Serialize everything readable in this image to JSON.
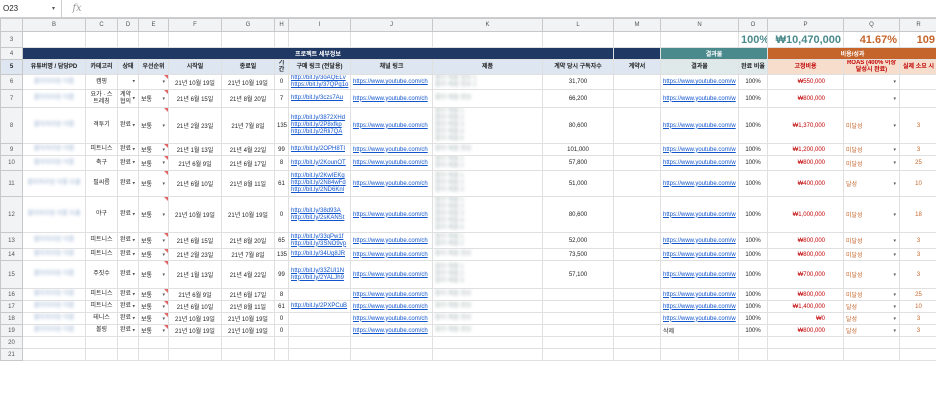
{
  "formula_bar": {
    "cell_ref": "O23",
    "fx": "fx"
  },
  "col_letters": [
    "A",
    "B",
    "C",
    "D",
    "E",
    "F",
    "G",
    "H",
    "I",
    "J",
    "K",
    "L",
    "M",
    "N",
    "O",
    "P",
    "Q",
    "R"
  ],
  "summary": {
    "pct_done": "100%",
    "cost_total": "₩10,470,000",
    "roas_pct": "41.67%",
    "count": "109"
  },
  "groups": {
    "project": "프로젝트 세부정보",
    "result": "결과물",
    "cost": "비용/성과"
  },
  "headers": [
    "유튜버명 / 담당PD",
    "카테고리",
    "상태",
    "우선순위",
    "시작일",
    "종료일",
    "기간",
    "구매 링크 (전달용)",
    "채널 링크",
    "제품",
    "계약 당시 구독자수",
    "계약서",
    "결과물",
    "완료 비율",
    "고정비용",
    "ROAS (400% 이상 달성시 완료)",
    "실제 소요 시"
  ],
  "rows": [
    {
      "rn": "6",
      "name": "블러처리된 이름",
      "cat": "캠핑",
      "status": "",
      "prio": "",
      "start": "21년 10월 19일",
      "end": "21년 10월 19일",
      "days": "0",
      "buy": [
        "http://bit.ly/3oAQELv",
        "https://bit.ly/37QPg1o"
      ],
      "ch": "https://www.youtube.com/ch",
      "prod": [
        "블러 제품 정보 1",
        "블러 제품 정보 2"
      ],
      "subs": "31,700",
      "res": "https://www.youtube.com/w",
      "pct": "100%",
      "fee": "₩550,000",
      "roas": "",
      "act": ""
    },
    {
      "rn": "7",
      "name": "블러처리된 이름",
      "cat": "요가 · 스트레칭",
      "status": "계약 협의",
      "prio": "보통",
      "start": "21년 6월 15일",
      "end": "21년 8월 20일",
      "days": "7",
      "buy": [
        "http://bit.ly/3czs7Au"
      ],
      "ch": "https://www.youtube.com/ch",
      "prod": [
        "블러 제품 정보"
      ],
      "subs": "66,200",
      "res": "https://www.youtube.com/w",
      "pct": "100%",
      "fee": "₩800,000",
      "roas": "",
      "act": ""
    },
    {
      "rn": "8",
      "name": "블러처리된 이름",
      "cat": "격투기",
      "status": "완료",
      "prio": "보통",
      "start": "21년 2월 23일",
      "end": "21년 7월 8일",
      "days": "135",
      "buy": [
        "http://bit.ly/3872XHd",
        "http://bit.ly/2P8xfkp",
        "http://bit.ly/2Rli7QA"
      ],
      "ch": "https://www.youtube.com/ch",
      "prod": [
        "블러 제품 1",
        "블러 제품 2",
        "블러 제품 3",
        "블러 제품 4",
        "블러 제품 5"
      ],
      "subs": "80,600",
      "res": "https://www.youtube.com/w",
      "pct": "100%",
      "fee": "₩1,370,000",
      "roas": "미달성",
      "act": "3"
    },
    {
      "rn": "9",
      "name": "블러처리된 이름",
      "cat": "피트니스",
      "status": "완료",
      "prio": "보통",
      "start": "21년 1월 13일",
      "end": "21년 4월 22일",
      "days": "99",
      "buy": [
        "http://bit.ly/2OPH8TI"
      ],
      "ch": "https://www.youtube.com/ch",
      "prod": [
        "블러 제품 정보"
      ],
      "subs": "101,000",
      "res": "https://www.youtube.com/w",
      "pct": "100%",
      "fee": "₩1,200,000",
      "roas": "미달성",
      "act": "3"
    },
    {
      "rn": "10",
      "name": "블러처리된 이름",
      "cat": "축구",
      "status": "완료",
      "prio": "보통",
      "start": "21년 6월 9일",
      "end": "21년 6월 17일",
      "days": "8",
      "buy": [
        "http://bit.ly/2KounOT"
      ],
      "ch": "https://www.youtube.com/ch",
      "prod": [
        "블러 제품 1",
        "블러 제품 2"
      ],
      "subs": "57,800",
      "res": "https://www.youtube.com/w",
      "pct": "100%",
      "fee": "₩800,000",
      "roas": "미달성",
      "act": "25"
    },
    {
      "rn": "11",
      "name": "블러처리된 이름 두줄",
      "cat": "필씨름",
      "status": "완료",
      "prio": "보통",
      "start": "21년 6월 10일",
      "end": "21년 8월 11일",
      "days": "61",
      "buy": [
        "http://bit.ly/2KwIEKg",
        "http://bit.ly/2N84wFd",
        "http://bit.ly/2ND6Knl"
      ],
      "ch": "https://www.youtube.com/ch",
      "prod": [
        "블러 제품 1",
        "블러 제품 2",
        "블러 제품 3"
      ],
      "subs": "51,000",
      "res": "https://www.youtube.com/w",
      "pct": "100%",
      "fee": "₩400,000",
      "roas": "달성",
      "act": "10"
    },
    {
      "rn": "12",
      "name": "블러처리된 이름 두줄",
      "cat": "야구",
      "status": "완료",
      "prio": "보통",
      "start": "21년 10월 19일",
      "end": "21년 10월 19일",
      "days": "0",
      "buy": [
        "http://bit.ly/38d93A",
        "http://bit.ly/2sKANSt"
      ],
      "ch": "https://www.youtube.com/ch",
      "prod": [
        "블러 제품 1",
        "블러 제품 2",
        "블러 제품 3",
        "블러 제품 4",
        "블러 제품 5"
      ],
      "subs": "80,600",
      "res": "https://www.youtube.com/w",
      "pct": "100%",
      "fee": "₩1,000,000",
      "roas": "미달성",
      "act": "18"
    },
    {
      "rn": "13",
      "name": "블러처리된 이름",
      "cat": "피트니스",
      "status": "완료",
      "prio": "보통",
      "start": "21년 6월 15일",
      "end": "21년 8월 20일",
      "days": "65",
      "buy": [
        "http://bit.ly/33qPw1f",
        "http://bit.ly/3SNO9vp"
      ],
      "ch": "https://www.youtube.com/ch",
      "prod": [
        "블러 제품 1",
        "블러 제품 2"
      ],
      "subs": "52,000",
      "res": "https://www.youtube.com/w",
      "pct": "100%",
      "fee": "₩800,000",
      "roas": "미달성",
      "act": "3"
    },
    {
      "rn": "14",
      "name": "블러처리된 이름",
      "cat": "피트니스",
      "status": "완료",
      "prio": "보통",
      "start": "21년 2월 23일",
      "end": "21년 7월 8일",
      "days": "135",
      "buy": [
        "http://bit.ly/34Ug8JR"
      ],
      "ch": "https://www.youtube.com/ch",
      "prod": [
        "블러 제품 정보"
      ],
      "subs": "73,500",
      "res": "https://www.youtube.com/w",
      "pct": "100%",
      "fee": "₩800,000",
      "roas": "미달성",
      "act": "3"
    },
    {
      "rn": "15",
      "name": "블러처리된 이름",
      "cat": "주짓수",
      "status": "완료",
      "prio": "보통",
      "start": "21년 1월 13일",
      "end": "21년 4월 22일",
      "days": "99",
      "buy": [
        "http://bit.ly/33ZUI1N",
        "http://bit.ly/2YALJh9"
      ],
      "ch": "https://www.youtube.com/ch",
      "prod": [
        "블러 제품 1",
        "블러 제품 2",
        "블러 제품 3"
      ],
      "subs": "57,100",
      "res": "https://www.youtube.com/w",
      "pct": "100%",
      "fee": "₩700,000",
      "roas": "미달성",
      "act": "3"
    },
    {
      "rn": "16",
      "name": "블러처리된 이름",
      "cat": "피트니스",
      "status": "완료",
      "prio": "보통",
      "start": "21년 6월 9일",
      "end": "21년 6월 17일",
      "days": "8",
      "buy": [],
      "ch": "https://www.youtube.com/ch",
      "prod": [
        "블러 제품 정보"
      ],
      "subs": "",
      "res": "https://www.youtube.com/w",
      "pct": "100%",
      "fee": "₩800,000",
      "roas": "미달성",
      "act": "25"
    },
    {
      "rn": "17",
      "name": "블러처리된 이름",
      "cat": "피트니스",
      "status": "완료",
      "prio": "보통",
      "start": "21년 6월 10일",
      "end": "21년 8월 11일",
      "days": "61",
      "buy": [
        "http://bit.ly/2PXPCuB"
      ],
      "ch": "https://www.youtube.com/ch",
      "prod": [
        "블러 제품 정보"
      ],
      "subs": "",
      "res": "https://www.youtube.com/w",
      "pct": "100%",
      "fee": "₩1,400,000",
      "roas": "달성",
      "act": "10"
    },
    {
      "rn": "18",
      "name": "블러처리된 이름",
      "cat": "테니스",
      "status": "완료",
      "prio": "보통",
      "start": "21년 10월 19일",
      "end": "21년 10월 19일",
      "days": "0",
      "buy": [],
      "ch": "https://www.youtube.com/ch",
      "prod": [
        "블러 제품 정보"
      ],
      "subs": "",
      "res": "https://www.youtube.com/w",
      "pct": "100%",
      "fee": "₩0",
      "roas": "달성",
      "act": "3"
    },
    {
      "rn": "19",
      "name": "블러처리된 이름",
      "cat": "볼링",
      "status": "완료",
      "prio": "보통",
      "start": "21년 10월 19일",
      "end": "21년 10월 19일",
      "days": "0",
      "buy": [],
      "ch": "https://www.youtube.com/ch",
      "prod": [
        "블러 제품 정보"
      ],
      "subs": "",
      "res": "삭제",
      "pct": "100%",
      "fee": "₩800,000",
      "roas": "달성",
      "act": "3"
    }
  ],
  "empty_rows": [
    "20",
    "21"
  ]
}
